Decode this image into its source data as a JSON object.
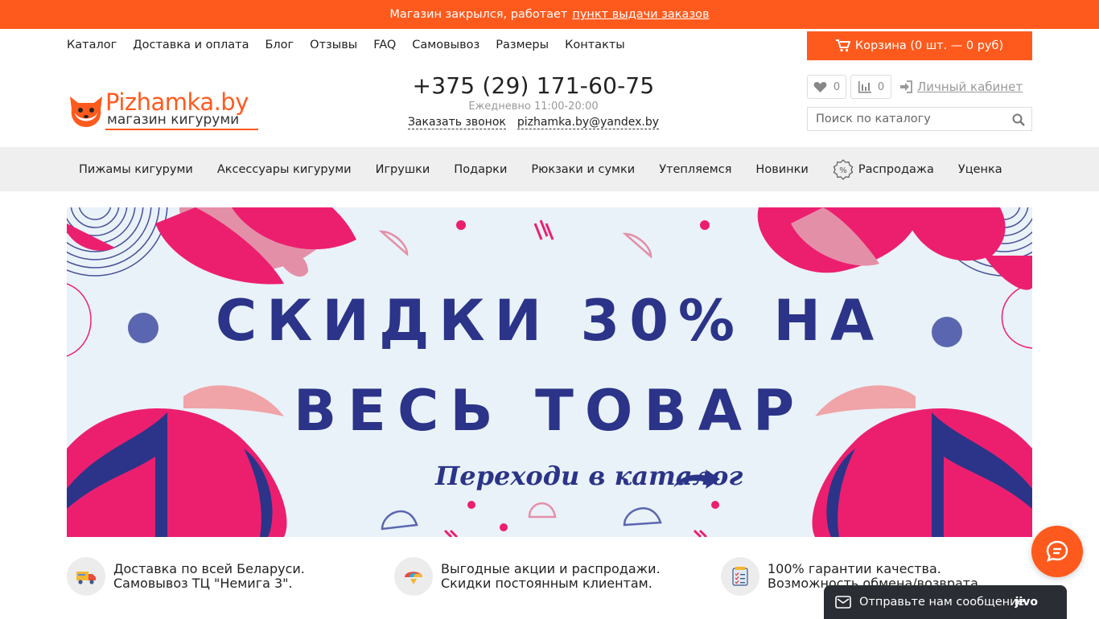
{
  "notice": {
    "text": "Магазин закрылся, работает",
    "link": "пункт выдачи заказов"
  },
  "topnav": [
    "Каталог",
    "Доставка и оплата",
    "Блог",
    "Отзывы",
    "FAQ",
    "Самовывоз",
    "Размеры",
    "Контакты"
  ],
  "cart": {
    "label": "Корзина (0 шт. — 0 руб)"
  },
  "logo": {
    "brand": "Pizhamka.by",
    "subtitle": "магазин кигуруми"
  },
  "contact": {
    "phone": "+375 (29) 171-60-75",
    "hours": "Ежедневно 11:00-20:00",
    "callback": "Заказать звонок",
    "email": "pizhamka.by@yandex.by"
  },
  "favorites": {
    "count": "0",
    "icon": "heart-icon"
  },
  "compare": {
    "count": "0",
    "icon": "bar-chart-icon"
  },
  "account": {
    "label": "Личный кабинет"
  },
  "search": {
    "placeholder": "Поиск по каталогу"
  },
  "categories": [
    "Пижамы кигуруми",
    "Аксессуары кигуруми",
    "Игрушки",
    "Подарки",
    "Рюкзаки и сумки",
    "Утепляемся",
    "Новинки",
    "Распродажа",
    "Уценка"
  ],
  "banner": {
    "line1": "СКИДКИ 30% НА",
    "line2": "ВЕСЬ ТОВАР",
    "cta": "Переходи в каталог"
  },
  "features": [
    {
      "line1": "Доставка по всей Беларуси.",
      "line2": "Самовывоз ТЦ \"Немига 3\".",
      "icon": "truck-icon"
    },
    {
      "line1": "Выгодные акции и распродажи.",
      "line2": "Скидки постоянным клиентам.",
      "icon": "balloon-icon"
    },
    {
      "line1": "100% гарантии качества.",
      "line2": "Возможность обмена/возврата.",
      "icon": "checklist-icon"
    }
  ],
  "chat": {
    "label": "Отправьте нам сообщение",
    "brand": "jivo"
  },
  "colors": {
    "accent": "#ff5a1d",
    "banner_text": "#2b3488",
    "pink": "#ec1f6f",
    "light_pink": "#e48fa8"
  }
}
